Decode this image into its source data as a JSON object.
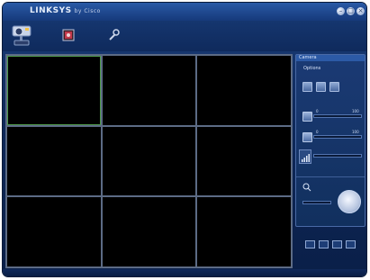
{
  "window": {
    "brand": "LINKSYS",
    "brand_sub": "by Cisco",
    "buttons": [
      {
        "name": "minimize-button",
        "glyph": "–"
      },
      {
        "name": "maximize-button",
        "glyph": "□"
      },
      {
        "name": "close-button",
        "glyph": "×"
      }
    ]
  },
  "toolbar": {
    "items": [
      {
        "name": "camera-view-tool",
        "icon": "camera-icon"
      },
      {
        "name": "playback-tool",
        "icon": "film-icon"
      },
      {
        "name": "settings-tool",
        "icon": "wrench-icon"
      }
    ]
  },
  "video_grid": {
    "rows": 3,
    "cols": 3,
    "selected_index": 0
  },
  "control_panel": {
    "header": "Camera",
    "section_label": "Options",
    "slider1": {
      "min_label": "0",
      "max_label": "100"
    },
    "slider2": {
      "min_label": "0",
      "max_label": "100"
    }
  },
  "layout_buttons": [
    {
      "name": "layout-1x1-button"
    },
    {
      "name": "layout-2x2-button"
    },
    {
      "name": "layout-3x3-button"
    },
    {
      "name": "layout-4x4-button"
    }
  ]
}
